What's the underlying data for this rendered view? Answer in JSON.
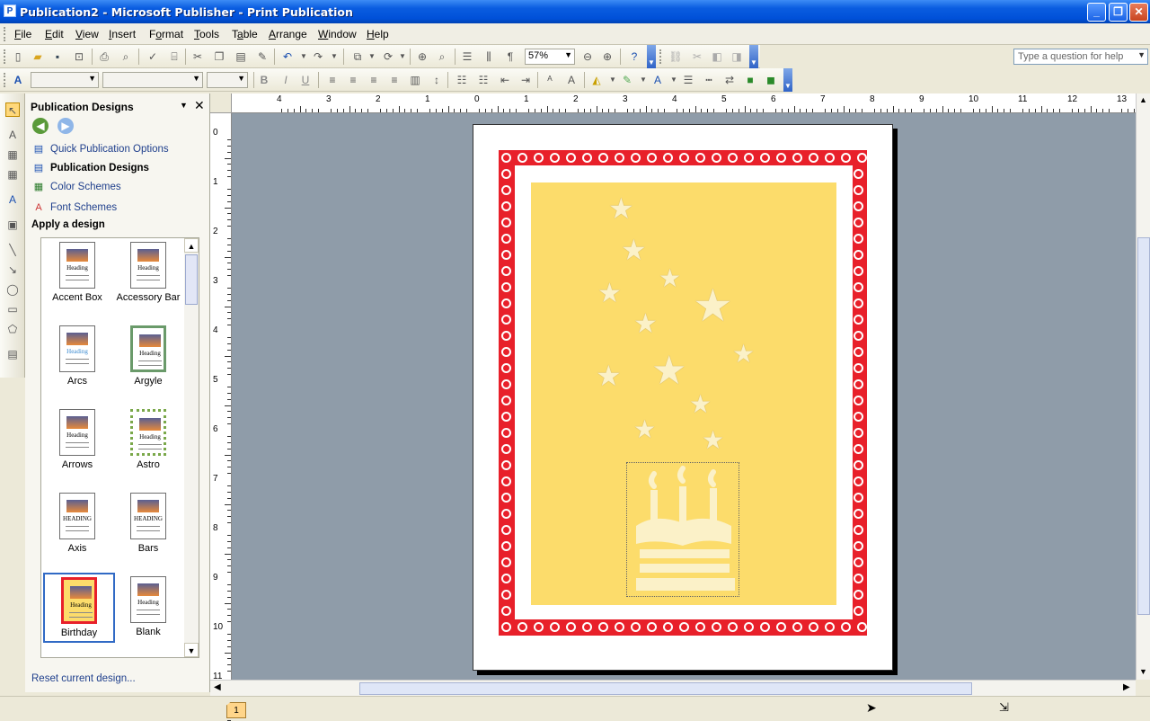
{
  "window": {
    "title": "Publication2 - Microsoft Publisher - Print Publication",
    "controls": [
      "_",
      "❐",
      "✕"
    ]
  },
  "menu": {
    "items": [
      {
        "label": "File",
        "key": "F"
      },
      {
        "label": "Edit",
        "key": "E"
      },
      {
        "label": "View",
        "key": "V"
      },
      {
        "label": "Insert",
        "key": "I"
      },
      {
        "label": "Format",
        "key": "o"
      },
      {
        "label": "Tools",
        "key": "T"
      },
      {
        "label": "Table",
        "key": "a"
      },
      {
        "label": "Arrange",
        "key": "A"
      },
      {
        "label": "Window",
        "key": "W"
      },
      {
        "label": "Help",
        "key": "H"
      }
    ],
    "help_placeholder": "Type a question for help"
  },
  "toolbar": {
    "zoom": "57%"
  },
  "taskpane": {
    "title": "Publication Designs",
    "links": [
      {
        "label": "Quick Publication Options",
        "icon": "quick-options-icon"
      },
      {
        "label": "Publication Designs",
        "icon": "designs-icon"
      },
      {
        "label": "Color Schemes",
        "icon": "color-schemes-icon"
      },
      {
        "label": "Font Schemes",
        "icon": "font-schemes-icon"
      }
    ],
    "section": "Apply a design",
    "designs": [
      {
        "name": "Accent Box",
        "heading": "Heading"
      },
      {
        "name": "Accessory Bar",
        "heading": "Heading"
      },
      {
        "name": "Arcs",
        "heading": "Heading"
      },
      {
        "name": "Argyle",
        "heading": "Heading"
      },
      {
        "name": "Arrows",
        "heading": "Heading"
      },
      {
        "name": "Astro",
        "heading": "Heading"
      },
      {
        "name": "Axis",
        "heading": "HEADING"
      },
      {
        "name": "Bars",
        "heading": "HEADING"
      },
      {
        "name": "Birthday",
        "heading": "Heading"
      },
      {
        "name": "Blank",
        "heading": "Heading"
      }
    ],
    "selected_design": "Birthday",
    "reset_link": "Reset current design..."
  },
  "ruler": {
    "h_labels": [
      "4",
      "3",
      "2",
      "1",
      "0",
      "1",
      "2",
      "3",
      "4",
      "5",
      "6",
      "7",
      "8",
      "9",
      "10",
      "11",
      "12",
      "13"
    ],
    "v_labels": [
      "0",
      "1",
      "2",
      "3",
      "4",
      "5",
      "6",
      "7",
      "8",
      "9",
      "10",
      "11"
    ]
  },
  "status": {
    "page_number": "1"
  },
  "colors": {
    "border_red": "#e8202a",
    "panel_yellow": "#fcdc6b",
    "workspace": "#8f9ca9"
  }
}
